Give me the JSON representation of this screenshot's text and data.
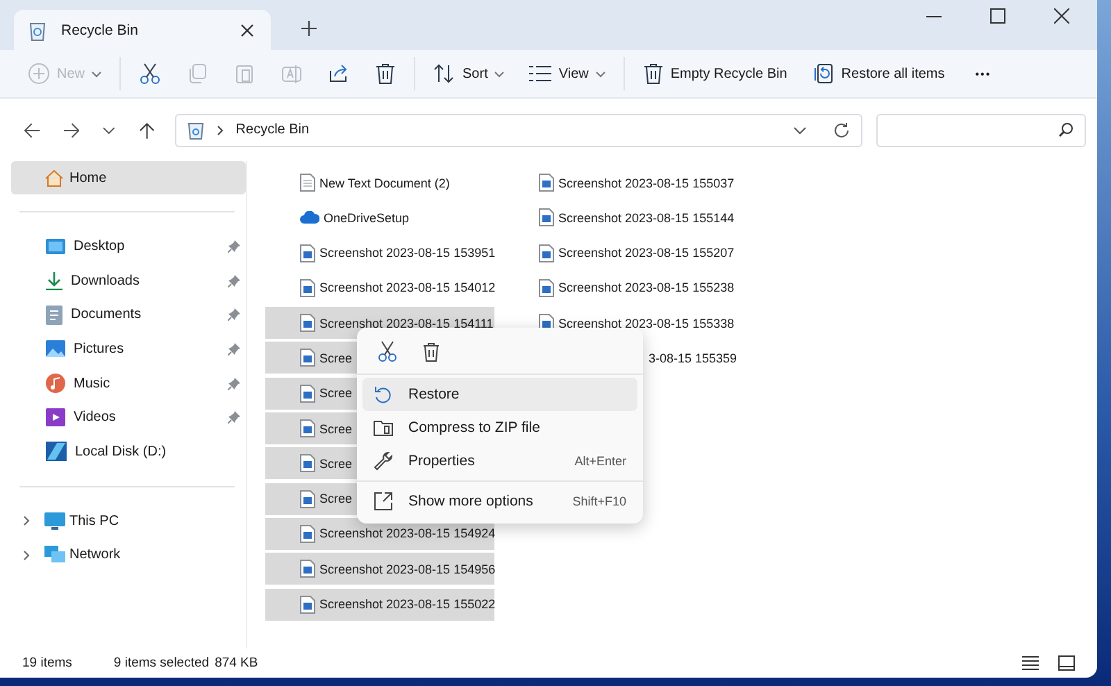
{
  "tab": {
    "title": "Recycle Bin",
    "selected": true
  },
  "toolbar": [
    {
      "label": "New",
      "disabled": true,
      "dropdown": true
    },
    {
      "disabled": false
    },
    {
      "disabled": true
    },
    {
      "disabled": true
    },
    {
      "disabled": true
    },
    {
      "disabled": false
    },
    {
      "disabled": false
    },
    {
      "label": "Sort",
      "disabled": false,
      "dropdown": true
    },
    {
      "label": "View",
      "disabled": false,
      "dropdown": true
    },
    {
      "label": "Empty Recycle Bin",
      "disabled": false,
      "dropdown": false
    },
    {
      "label": "Restore all items",
      "disabled": false,
      "dropdown": false
    },
    {
      "label": "•••",
      "disabled": false,
      "dropdown": false
    }
  ],
  "address": {
    "path": "Recycle Bin"
  },
  "sidebar": {
    "home": {
      "label": "Home",
      "selected": true
    },
    "quick_access": [
      {
        "label": "Desktop",
        "pinned": true
      },
      {
        "label": "Downloads",
        "pinned": true
      },
      {
        "label": "Documents",
        "pinned": true
      },
      {
        "label": "Pictures",
        "pinned": true
      },
      {
        "label": "Music",
        "pinned": true
      },
      {
        "label": "Videos",
        "pinned": true
      },
      {
        "label": "Local Disk (D:)",
        "pinned": false
      }
    ],
    "tree": [
      {
        "label": "This PC",
        "expanded": false
      },
      {
        "label": "Network",
        "expanded": false
      }
    ]
  },
  "files": [
    {
      "name": "New Text Document (2)",
      "kind": "text",
      "selected": false
    },
    {
      "name": "OneDriveSetup",
      "kind": "cloud",
      "selected": false
    },
    {
      "name": "Screenshot 2023-08-15 153951",
      "kind": "image",
      "selected": false
    },
    {
      "name": "Screenshot 2023-08-15 154012",
      "kind": "image",
      "selected": false
    },
    {
      "name": "Screenshot 2023-08-15 154111",
      "kind": "image",
      "selected": true
    },
    {
      "name": "Scree",
      "kind": "image",
      "selected": true
    },
    {
      "name": "Scree",
      "kind": "image",
      "selected": true
    },
    {
      "name": "Scree",
      "kind": "image",
      "selected": true
    },
    {
      "name": "Scree",
      "kind": "image",
      "selected": true
    },
    {
      "name": "Scree",
      "kind": "image",
      "selected": true
    },
    {
      "name": "Screenshot 2023-08-15 154924",
      "kind": "image",
      "selected": true
    },
    {
      "name": "Screenshot 2023-08-15 154956",
      "kind": "image",
      "selected": true
    },
    {
      "name": "Screenshot 2023-08-15 155022",
      "kind": "image",
      "selected": true
    },
    {
      "name": "Screenshot 2023-08-15 155037",
      "kind": "image",
      "selected": false
    },
    {
      "name": "Screenshot 2023-08-15 155144",
      "kind": "image",
      "selected": false
    },
    {
      "name": "Screenshot 2023-08-15 155207",
      "kind": "image",
      "selected": false
    },
    {
      "name": "Screenshot 2023-08-15 155238",
      "kind": "image",
      "selected": false
    },
    {
      "name": "Screenshot 2023-08-15 155338",
      "kind": "image",
      "selected": false
    },
    {
      "name": "3-08-15 155359",
      "kind": "covered",
      "selected": false
    }
  ],
  "context_menu": {
    "items": [
      {
        "label": "Restore",
        "selected": true,
        "separator_before": false
      },
      {
        "label": "Compress to ZIP file",
        "selected": false,
        "separator_before": false
      },
      {
        "label": "Properties",
        "shortcut": "Alt+Enter",
        "selected": false,
        "separator_before": false
      },
      {
        "label": "Show more options",
        "shortcut": "Shift+F10",
        "selected": false,
        "separator_before": true
      }
    ]
  },
  "status_bar": {
    "count": "19 items",
    "selection": "9 items selected",
    "size": "874 KB"
  }
}
